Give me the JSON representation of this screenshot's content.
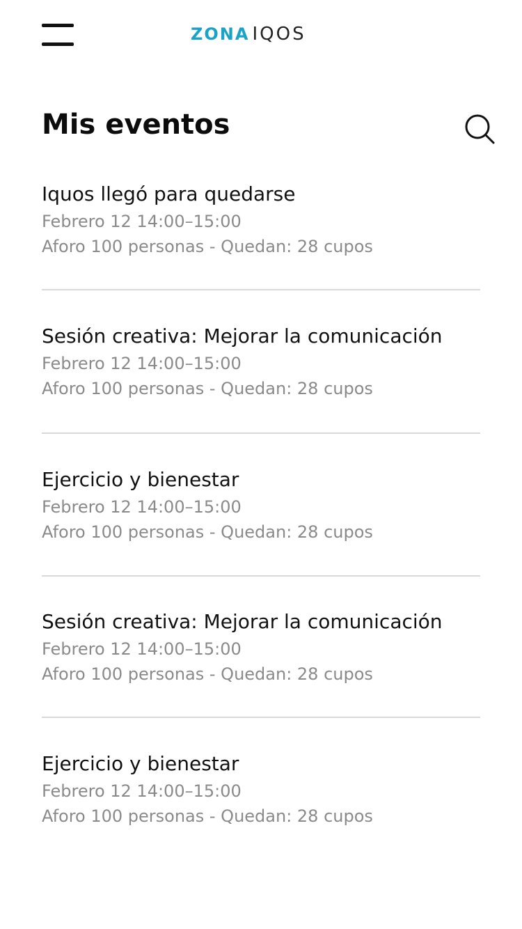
{
  "header": {
    "logo_part1": "ZONA",
    "logo_part2": "IQOS",
    "menu_icon": "hamburger-menu-icon"
  },
  "page": {
    "title": "Mis eventos",
    "search_icon": "search-icon"
  },
  "events": [
    {
      "title": "Iquos llegó para quedarse",
      "date": "Febrero 12 14:00–15:00",
      "capacity": "Aforo 100 personas - Quedan: 28 cupos"
    },
    {
      "title": "Sesión creativa: Mejorar la comunicación",
      "date": "Febrero 12 14:00–15:00",
      "capacity": "Aforo 100 personas - Quedan: 28 cupos"
    },
    {
      "title": "Ejercicio y bienestar",
      "date": "Febrero 12 14:00–15:00",
      "capacity": "Aforo 100 personas - Quedan: 28 cupos"
    },
    {
      "title": "Sesión creativa: Mejorar la comunicación",
      "date": "Febrero 12 14:00–15:00",
      "capacity": "Aforo 100 personas - Quedan: 28 cupos"
    },
    {
      "title": "Ejercicio y bienestar",
      "date": "Febrero 12 14:00–15:00",
      "capacity": "Aforo 100 personas - Quedan: 28 cupos"
    }
  ],
  "colors": {
    "logo_accent": "#1aa3c8",
    "secondary_text": "#8a8a8a",
    "divider": "#d9d9d9"
  }
}
